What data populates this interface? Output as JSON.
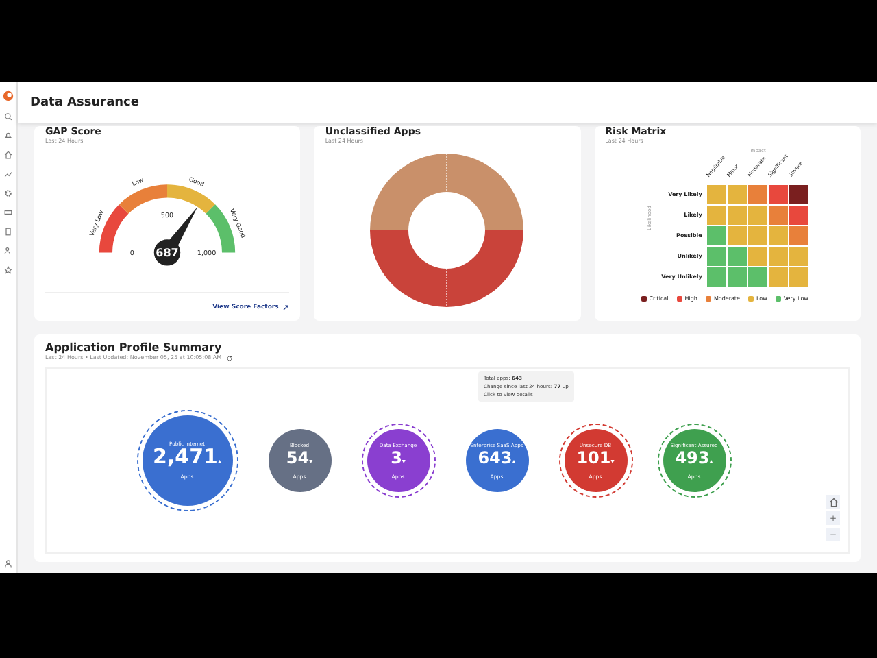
{
  "header": {
    "title": "Data Assurance"
  },
  "gap_score": {
    "title": "GAP Score",
    "subtitle": "Last 24 Hours",
    "value": "687",
    "min": "0",
    "mid": "500",
    "max": "1,000",
    "bands": [
      "Very Low",
      "Low",
      "Good",
      "Very Good"
    ],
    "link": "View Score Factors"
  },
  "unclassified_apps": {
    "title": "Unclassified Apps",
    "subtitle": "Last 24 Hours"
  },
  "risk_matrix": {
    "title": "Risk Matrix",
    "subtitle": "Last 24 Hours",
    "x_title": "Impact",
    "y_title": "Likelihood",
    "columns": [
      "Negligible",
      "Minor",
      "Moderate",
      "Significant",
      "Severe"
    ],
    "rows": [
      {
        "label": "Very Likely",
        "cells": [
          {
            "color": "#e4b43e"
          },
          {
            "color": "#e4b43e"
          },
          {
            "color": "#e8803a"
          },
          {
            "color": "#e8483d"
          },
          {
            "color": "#7a1f1f"
          }
        ]
      },
      {
        "label": "Likely",
        "cells": [
          {
            "color": "#e4b43e"
          },
          {
            "color": "#e4b43e"
          },
          {
            "color": "#e4b43e"
          },
          {
            "color": "#e8803a"
          },
          {
            "color": "#e8483d"
          }
        ]
      },
      {
        "label": "Possible",
        "cells": [
          {
            "color": "#5cbf6a"
          },
          {
            "color": "#e4b43e"
          },
          {
            "color": "#e4b43e"
          },
          {
            "color": "#e4b43e"
          },
          {
            "color": "#e8803a"
          }
        ]
      },
      {
        "label": "Unlikely",
        "cells": [
          {
            "color": "#5cbf6a"
          },
          {
            "color": "#5cbf6a"
          },
          {
            "color": "#e4b43e"
          },
          {
            "color": "#e4b43e"
          },
          {
            "color": "#e4b43e"
          }
        ]
      },
      {
        "label": "Very Unlikely",
        "cells": [
          {
            "color": "#5cbf6a"
          },
          {
            "color": "#5cbf6a"
          },
          {
            "color": "#5cbf6a"
          },
          {
            "color": "#e4b43e"
          },
          {
            "color": "#e4b43e"
          }
        ]
      }
    ],
    "legend": [
      {
        "label": "Critical",
        "color": "#7a1f1f"
      },
      {
        "label": "High",
        "color": "#e8483d"
      },
      {
        "label": "Moderate",
        "color": "#e8803a"
      },
      {
        "label": "Low",
        "color": "#e4b43e"
      },
      {
        "label": "Very Low",
        "color": "#5cbf6a"
      }
    ]
  },
  "summary": {
    "title": "Application Profile Summary",
    "subtitle": "Last 24 Hours • Last Updated: November 05, 25 at 10:05:08 AM",
    "bubbles": [
      {
        "label": "Public Internet",
        "count": "2,471",
        "trend": "▴",
        "unit": "Apps",
        "color": "#3a6fd0",
        "ringed": true,
        "kind": "large"
      },
      {
        "label": "Blocked",
        "count": "54",
        "trend": "▾",
        "unit": "Apps",
        "color": "#667085",
        "ringed": false,
        "kind": "small"
      },
      {
        "label": "Data Exchange",
        "count": "3",
        "trend": "▾",
        "unit": "Apps",
        "color": "#8a3fd0",
        "ringed": true,
        "kind": "small"
      },
      {
        "label": "Enterprise SaaS Apps",
        "count": "643",
        "trend": "▴",
        "unit": "Apps",
        "color": "#3a6fd0",
        "ringed": false,
        "kind": "small"
      },
      {
        "label": "Unsecure DB",
        "count": "101",
        "trend": "▾",
        "unit": "Apps",
        "color": "#d23a32",
        "ringed": true,
        "kind": "small"
      },
      {
        "label": "Significant Assured",
        "count": "493",
        "trend": "▴",
        "unit": "Apps",
        "color": "#3fa04f",
        "ringed": true,
        "kind": "small"
      }
    ],
    "tooltip": [
      "Total apps: **643**",
      "Change since last 24 hours: **77** up",
      "Click to view details"
    ],
    "zoom_controls": [
      "+",
      "−"
    ]
  }
}
